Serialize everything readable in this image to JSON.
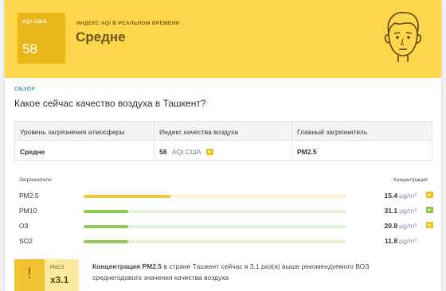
{
  "hero": {
    "aqi_label": "AQI США",
    "aqi_value": "58",
    "subtitle": "ИНДЕКС AQI В РЕАЛЬНОМ ВРЕМЕНИ",
    "status": "Средне",
    "face_icon": "neutral-face-icon",
    "color": "#fdd64b"
  },
  "overview": {
    "label": "ОБЗОР",
    "question": "Какое сейчас качество воздуха в Ташкент?",
    "headers": [
      "Уровень загрязнения атмосферы",
      "Индекс качества воздуха",
      "Главный загрязнитель"
    ],
    "level": "Средне",
    "index_value": "58",
    "index_unit": "AQI США",
    "main_pollutant": "PM2.5"
  },
  "pollutants": {
    "col_pollutants": "Загрязнители",
    "col_concentration": "Концентрация",
    "unit": "µg/m³",
    "items": [
      {
        "name": "PM2.5",
        "value": "15.4",
        "fill": 0.33,
        "color": "#f5c83a",
        "track": "#fbeecb",
        "trend": "up"
      },
      {
        "name": "PM10",
        "value": "31.1",
        "fill": 0.17,
        "color": "#8ccd4f",
        "track": "#e3f2d4",
        "trend": "down"
      },
      {
        "name": "O3",
        "value": "20.8",
        "fill": 0.17,
        "color": "#8ccd4f",
        "track": "#e3f2d4",
        "trend": "up"
      },
      {
        "name": "SO2",
        "value": "11.8",
        "fill": 0.17,
        "color": "#8ccd4f",
        "track": "#e3f2d4",
        "trend": "none"
      }
    ]
  },
  "warning": {
    "icon": "exclamation-icon",
    "label": "PM2.5",
    "multiplier": "x3.1",
    "message_bold": "Концентрация PM2.5",
    "message_rest": " в стране Ташкент сейчас в 3.1 раз(а) выше рекомендуемого ВОЗ среднегодового значения качества воздуха"
  }
}
